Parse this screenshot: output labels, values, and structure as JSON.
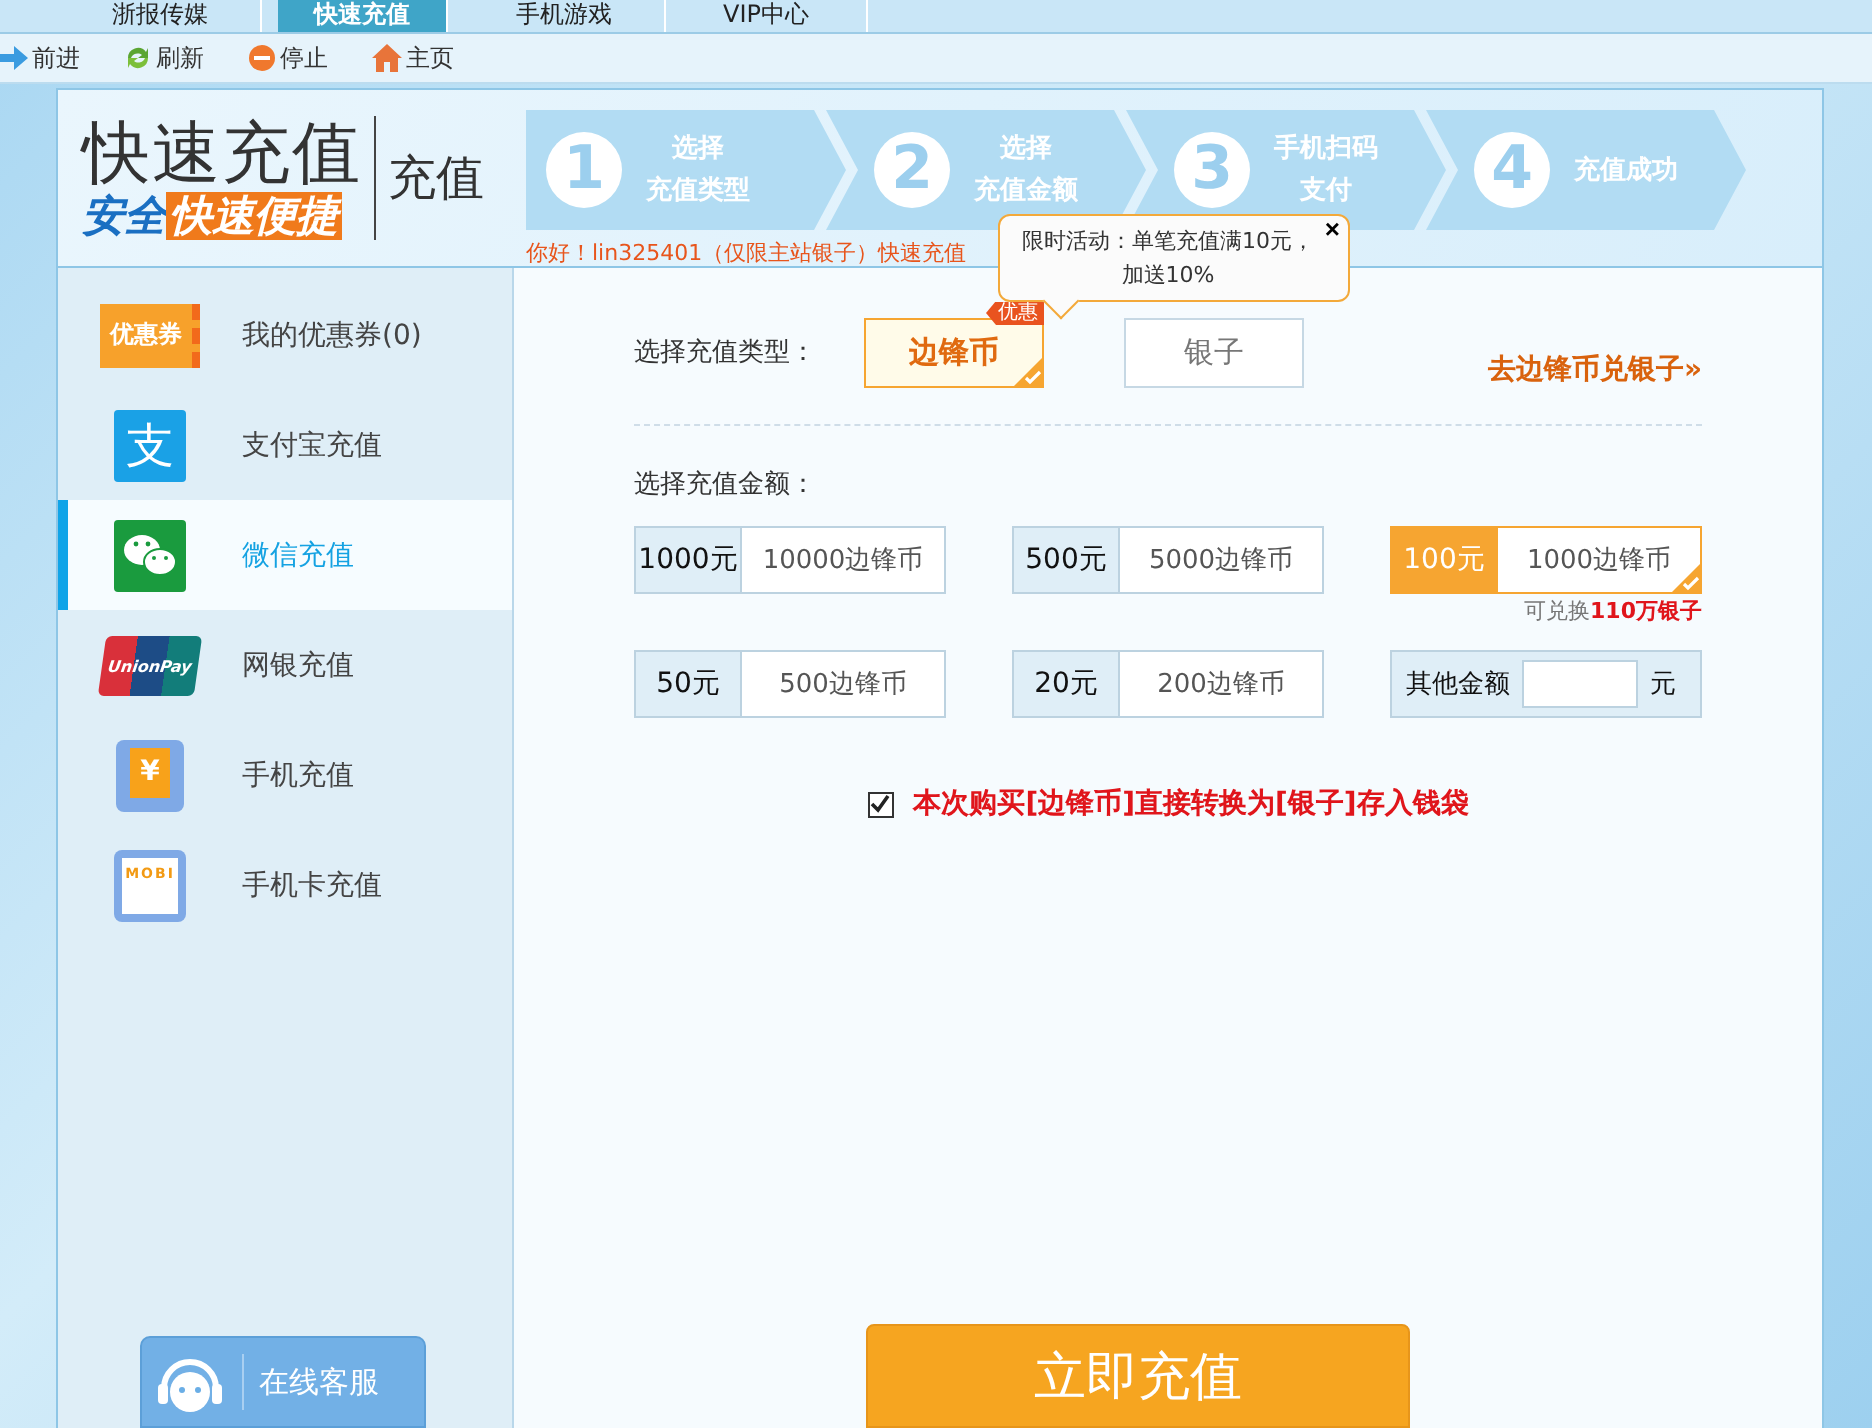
{
  "top_tabs": [
    {
      "label": "浙报传媒",
      "selected": false
    },
    {
      "label": "快速充值",
      "selected": true
    },
    {
      "label": "手机游戏",
      "selected": false
    },
    {
      "label": "VIP中心",
      "selected": false
    }
  ],
  "toolbar": [
    {
      "kind": "forward",
      "label": "前进"
    },
    {
      "kind": "refresh",
      "label": "刷新"
    },
    {
      "kind": "stop",
      "label": "停止"
    },
    {
      "kind": "home",
      "label": "主页"
    }
  ],
  "header": {
    "logo_title": "快速充值",
    "logo_blue": "安全",
    "logo_orange": "快速便捷",
    "section": "充值",
    "steps": [
      {
        "number": "1",
        "label": "选择",
        "label_2": "充值类型"
      },
      {
        "number": "2",
        "label": "选择",
        "label_2": "充值金额"
      },
      {
        "number": "3",
        "label": "手机扫码",
        "label_2": "支付"
      },
      {
        "number": "4",
        "label": "充值成功"
      }
    ],
    "greeting": "你好！lin325401（仅限主站银子）快速充值"
  },
  "tooltip": {
    "text": "限时活动：单笔充值满10元，加送10%",
    "close": "×"
  },
  "sidebar": {
    "items": [
      {
        "kind": "coupon",
        "icon_text": "优惠券",
        "label": "我的优惠券(0)",
        "selected": false
      },
      {
        "kind": "alipay",
        "icon_text": "支",
        "label": "支付宝充值",
        "selected": false
      },
      {
        "kind": "wechat",
        "label": "微信充值",
        "selected": true
      },
      {
        "kind": "unionpay",
        "icon_text": "UnionPay",
        "label": "网银充值",
        "selected": false
      },
      {
        "kind": "phone",
        "icon_text": "¥",
        "label": "手机充值",
        "selected": false
      },
      {
        "kind": "card",
        "icon_text": "MOBI",
        "label": "手机卡充值",
        "selected": false
      }
    ],
    "service_button": "在线客服"
  },
  "content": {
    "type_label": "选择充值类型：",
    "types": [
      {
        "label": "边锋币",
        "badge": "优惠",
        "selected": true
      },
      {
        "label": "银子",
        "selected": false
      }
    ],
    "exchange_link": "去边锋币兑银子»",
    "amount_label": "选择充值金额：",
    "amounts": [
      {
        "price": "1000元",
        "coins": "10000边锋币",
        "selected": false
      },
      {
        "price": "500元",
        "coins": "5000边锋币",
        "selected": false
      },
      {
        "price": "100元",
        "coins": "1000边锋币",
        "selected": true,
        "note": "可兑换**110万银子**"
      },
      {
        "price": "50元",
        "coins": "500边锋币",
        "selected": false
      },
      {
        "price": "20元",
        "coins": "200边锋币",
        "selected": false
      }
    ],
    "other_amount": {
      "label": "其他金额",
      "unit": "元"
    },
    "convert": {
      "checked": true,
      "label": "本次购买[边锋币]直接转换为[银子]存入钱袋"
    },
    "submit": "立即充值"
  }
}
